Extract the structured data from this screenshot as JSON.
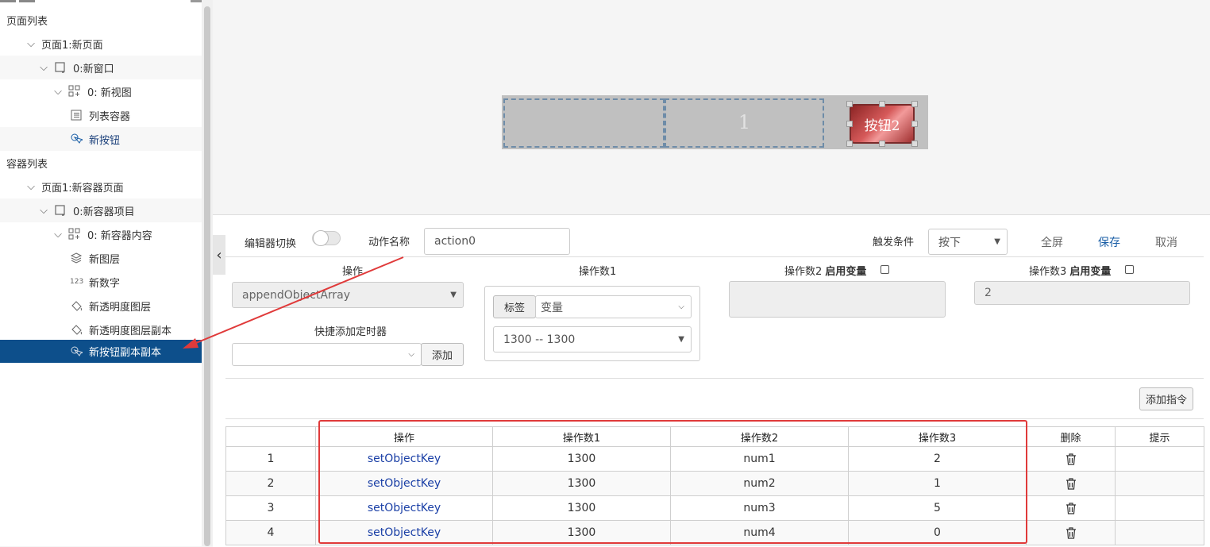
{
  "sidebar": {
    "page_list_title": "页面列表",
    "page_tree": [
      {
        "label": "页面1:新页面"
      },
      {
        "label": "0:新窗口"
      },
      {
        "label": "0: 新视图"
      },
      {
        "label": "列表容器"
      },
      {
        "label": "新按钮"
      }
    ],
    "container_list_title": "容器列表",
    "container_tree": [
      {
        "label": "页面1:新容器页面"
      },
      {
        "label": "0:新容器项目"
      },
      {
        "label": "0: 新容器内容"
      },
      {
        "label": "新图层"
      },
      {
        "label": "新数字",
        "icon_text": "123"
      },
      {
        "label": "新透明度图层"
      },
      {
        "label": "新透明度图层副本"
      },
      {
        "label": "新按钮副本副本"
      }
    ]
  },
  "preview": {
    "number_text": "1",
    "button_label": "按钮2"
  },
  "editor": {
    "toggle_label": "编辑器切换",
    "action_name_label": "动作名称",
    "action_name_value": "action0",
    "trigger_label": "触发条件",
    "trigger_value": "按下",
    "fullscreen": "全屏",
    "save": "保存",
    "cancel": "取消",
    "operation_label": "操作",
    "operation_value": "appendObjectArray",
    "quick_timer_label": "快捷添加定时器",
    "quick_timer_value": "",
    "add_button": "添加",
    "operand1_label": "操作数1",
    "operand1_tag": "标签",
    "operand1_type": "变量",
    "operand1_value": "1300 -- 1300",
    "operand2_label": "操作数2",
    "operand3_label": "操作数3",
    "enable_var_label": "启用变量",
    "operand2_value": "",
    "operand3_value": "2",
    "add_command_button": "添加指令"
  },
  "table": {
    "headers": [
      "",
      "操作",
      "操作数1",
      "操作数2",
      "操作数3",
      "删除",
      "提示"
    ],
    "rows": [
      {
        "index": "1",
        "op": "setObjectKey",
        "a1": "1300",
        "a2": "num1",
        "a3": "2",
        "hint": ""
      },
      {
        "index": "2",
        "op": "setObjectKey",
        "a1": "1300",
        "a2": "num2",
        "a3": "1",
        "hint": ""
      },
      {
        "index": "3",
        "op": "setObjectKey",
        "a1": "1300",
        "a2": "num3",
        "a3": "5",
        "hint": ""
      },
      {
        "index": "4",
        "op": "setObjectKey",
        "a1": "1300",
        "a2": "num4",
        "a3": "0",
        "hint": ""
      }
    ]
  },
  "colors": {
    "selected_row": "#0d4f8b",
    "accent_link": "#1a5ea6",
    "annotation_red": "#e03a3a"
  }
}
